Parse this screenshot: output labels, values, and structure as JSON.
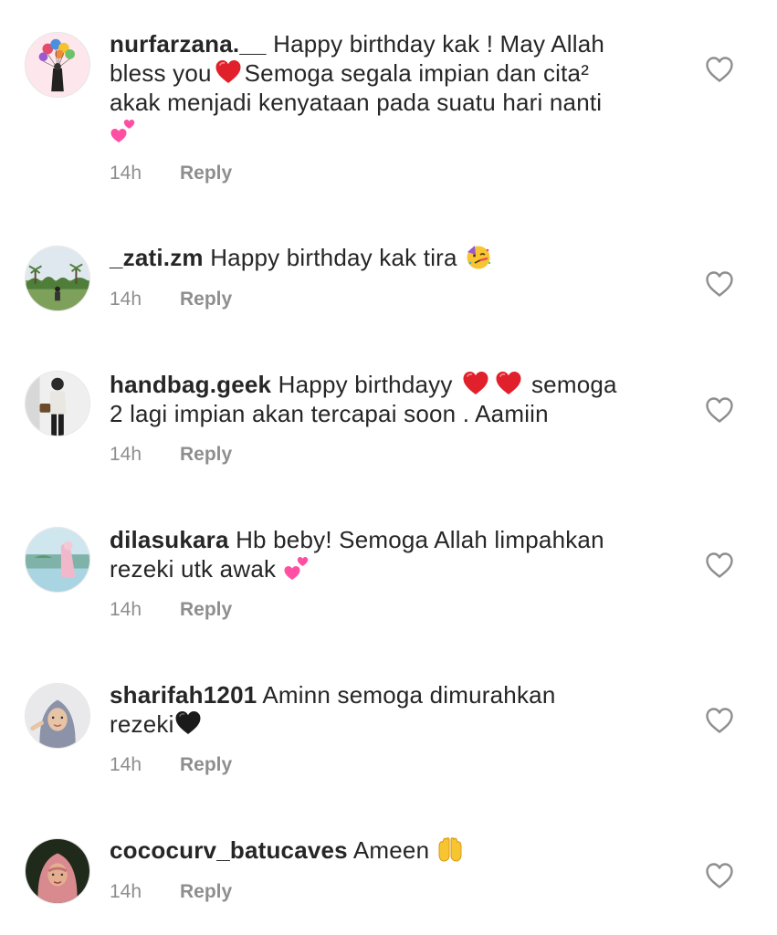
{
  "comments": [
    {
      "username": "nurfarzana.__",
      "text_lines": [
        "Happy birthday kak ! May Allah",
        "bless you",
        "Semoga segala impian dan cita²",
        "akak menjadi kenyataan pada suatu hari nanti"
      ],
      "emojis": [
        "red-heart",
        "two-hearts"
      ],
      "time": "14h",
      "reply": "Reply",
      "avatar_icon": "balloons-avatar"
    },
    {
      "username": "_zati.zm",
      "text": "Happy birthday kak tira",
      "emojis": [
        "partying-face"
      ],
      "time": "14h",
      "reply": "Reply",
      "avatar_icon": "landscape-avatar"
    },
    {
      "username": "handbag.geek",
      "text_lines": [
        "Happy birthdayy",
        "semoga",
        "2 lagi impian akan tercapai soon . Aamiin"
      ],
      "emojis": [
        "red-heart",
        "red-heart"
      ],
      "time": "14h",
      "reply": "Reply",
      "avatar_icon": "person-avatar"
    },
    {
      "username": "dilasukara",
      "text_lines": [
        "Hb beby! Semoga Allah limpahkan",
        "rezeki utk awak"
      ],
      "emojis": [
        "two-hearts"
      ],
      "time": "14h",
      "reply": "Reply",
      "avatar_icon": "lake-avatar"
    },
    {
      "username": "sharifah1201",
      "text_lines": [
        "Aminn semoga dimurahkan",
        "rezeki"
      ],
      "emojis": [
        "black-heart"
      ],
      "time": "14h",
      "reply": "Reply",
      "avatar_icon": "hijab-avatar"
    },
    {
      "username": "cococurv_batucaves",
      "text": "Ameen",
      "emojis": [
        "open-hands"
      ],
      "time": "14h",
      "reply": "Reply",
      "avatar_icon": "hijab-pink-avatar"
    }
  ],
  "colors": {
    "text": "#262626",
    "meta": "#8e8e8e",
    "heart_red": "#e02020",
    "heart_pink": "#ff5ca8"
  }
}
